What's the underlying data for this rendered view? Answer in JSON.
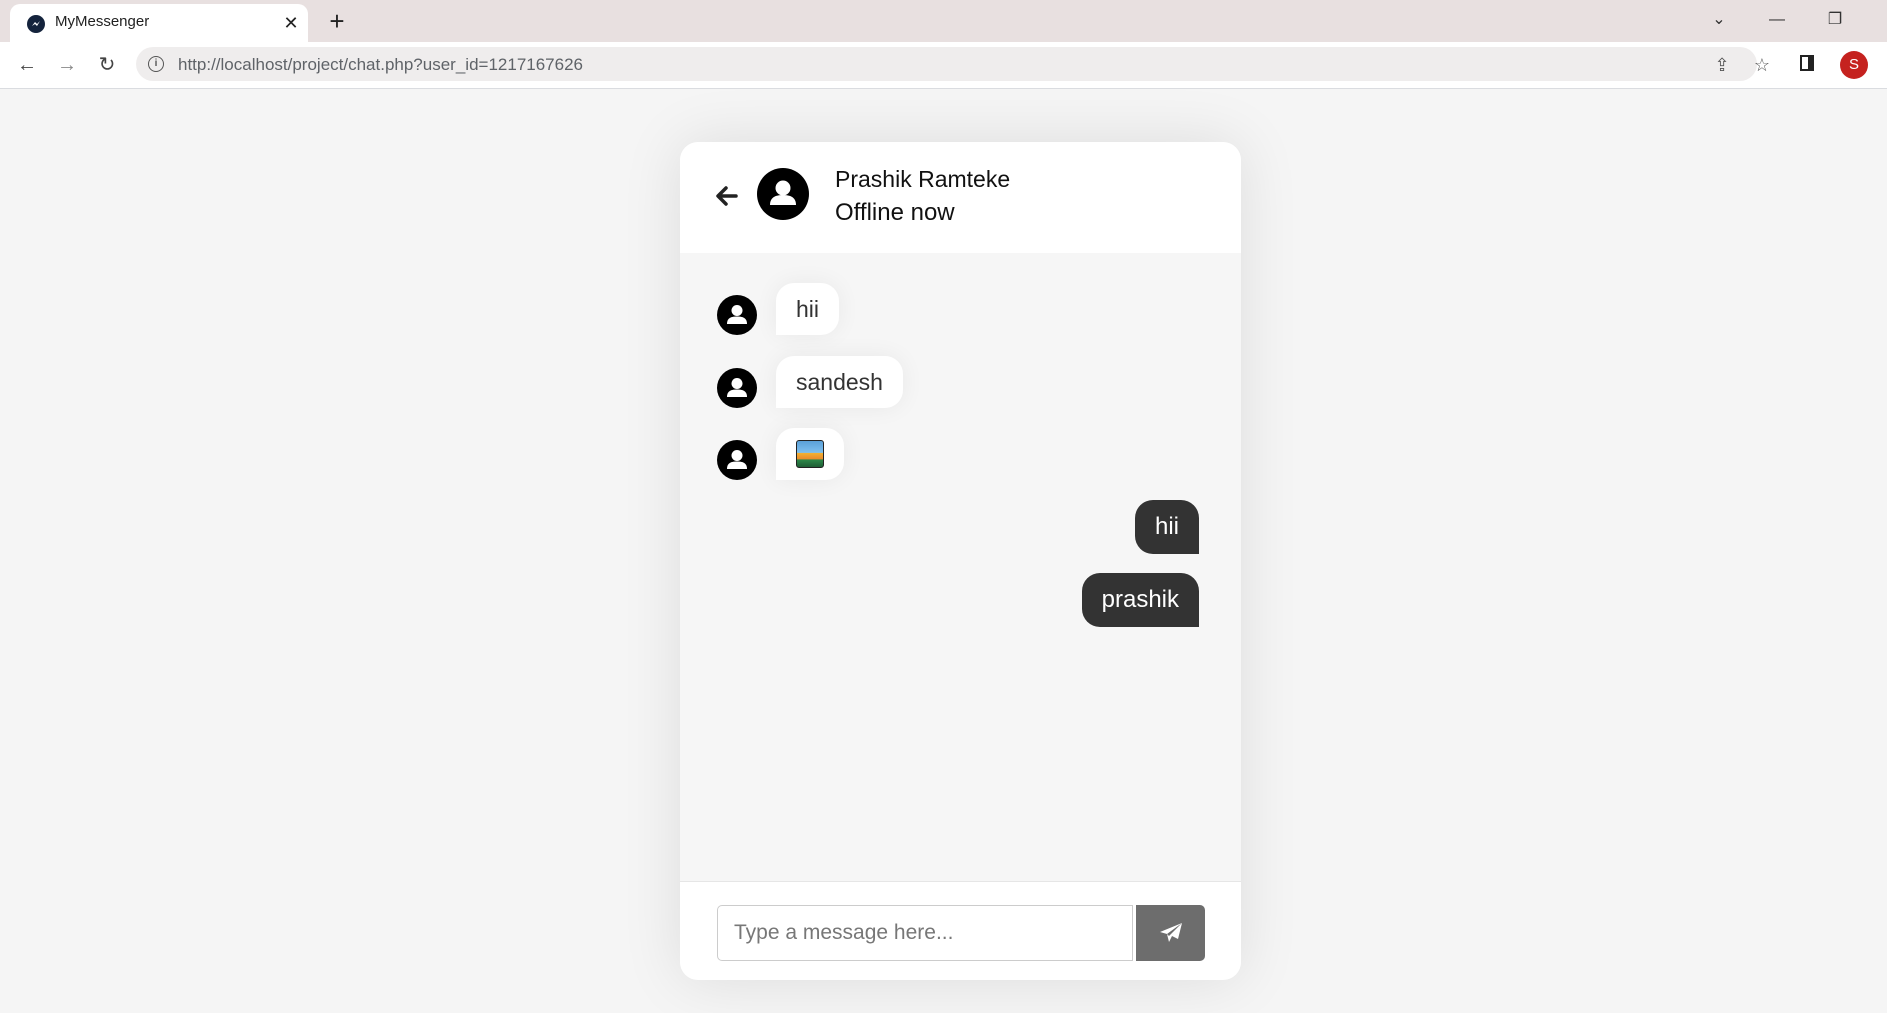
{
  "browser": {
    "tab_title": "MyMessenger",
    "tab_close": "✕",
    "new_tab": "+",
    "url": "http://localhost/project/chat.php?user_id=1217167626",
    "profile_initial": "S"
  },
  "chat": {
    "header": {
      "name": "Prashik Ramteke",
      "status": "Offline now"
    },
    "incoming_messages": [
      "hii",
      "sandesh"
    ],
    "outgoing_messages": [
      "hii",
      "prashik"
    ],
    "input_placeholder": "Type a message here..."
  },
  "colors": {
    "page_background": "#f5f5f5",
    "outgoing_bubble": "#333333",
    "send_button": "#6d6d6d",
    "profile_avatar": "#c5221f"
  },
  "icons": {
    "back": "arrow-left-icon",
    "avatar": "user-circle-icon",
    "send": "paper-plane-icon",
    "image_message": "image-icon"
  }
}
